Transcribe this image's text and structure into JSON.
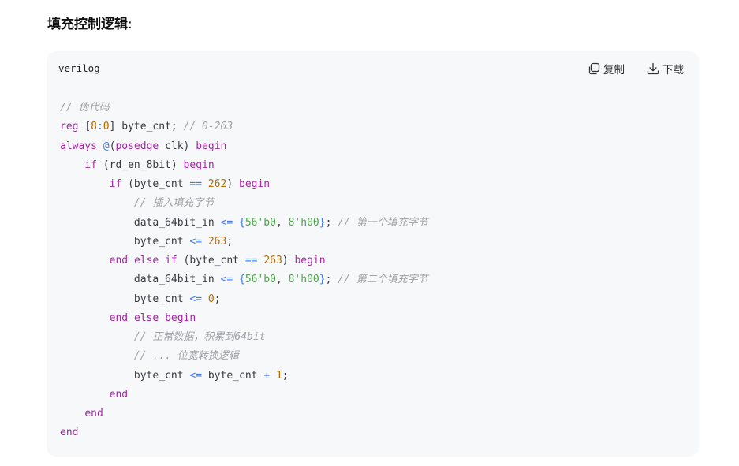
{
  "heading": {
    "title": "填充控制逻辑",
    "suffix": ":"
  },
  "code_block": {
    "language": "verilog",
    "copy_label": "复制",
    "download_label": "下载",
    "colors": {
      "background": "#f7f8fa",
      "keyword": "#a626a4",
      "number": "#b76b01",
      "string": "#50a14f",
      "operator": "#4078f2",
      "comment": "#a0a1a7",
      "plain": "#383a42"
    },
    "lines": [
      [
        {
          "t": "cmt",
          "v": "// 伪代码"
        }
      ],
      [
        {
          "t": "kw",
          "v": "reg"
        },
        {
          "t": "plain",
          "v": " ["
        },
        {
          "t": "num",
          "v": "8"
        },
        {
          "t": "op",
          "v": ":"
        },
        {
          "t": "num",
          "v": "0"
        },
        {
          "t": "plain",
          "v": "] byte_cnt; "
        },
        {
          "t": "cmt",
          "v": "// 0-263"
        }
      ],
      [
        {
          "t": "kw",
          "v": "always"
        },
        {
          "t": "plain",
          "v": " "
        },
        {
          "t": "op",
          "v": "@"
        },
        {
          "t": "plain",
          "v": "("
        },
        {
          "t": "kw",
          "v": "posedge"
        },
        {
          "t": "plain",
          "v": " clk) "
        },
        {
          "t": "kw",
          "v": "begin"
        }
      ],
      [
        {
          "t": "plain",
          "v": "    "
        },
        {
          "t": "kw",
          "v": "if"
        },
        {
          "t": "plain",
          "v": " (rd_en_8bit) "
        },
        {
          "t": "kw",
          "v": "begin"
        }
      ],
      [
        {
          "t": "plain",
          "v": "        "
        },
        {
          "t": "kw",
          "v": "if"
        },
        {
          "t": "plain",
          "v": " (byte_cnt "
        },
        {
          "t": "op",
          "v": "=="
        },
        {
          "t": "plain",
          "v": " "
        },
        {
          "t": "num",
          "v": "262"
        },
        {
          "t": "plain",
          "v": ") "
        },
        {
          "t": "kw",
          "v": "begin"
        }
      ],
      [
        {
          "t": "plain",
          "v": "            "
        },
        {
          "t": "cmt",
          "v": "// 插入填充字节"
        }
      ],
      [
        {
          "t": "plain",
          "v": "            data_64bit_in "
        },
        {
          "t": "op",
          "v": "<="
        },
        {
          "t": "plain",
          "v": " "
        },
        {
          "t": "op",
          "v": "{"
        },
        {
          "t": "str",
          "v": "56'b0"
        },
        {
          "t": "plain",
          "v": ", "
        },
        {
          "t": "str",
          "v": "8'h00"
        },
        {
          "t": "op",
          "v": "}"
        },
        {
          "t": "plain",
          "v": "; "
        },
        {
          "t": "cmt",
          "v": "// 第一个填充字节"
        }
      ],
      [
        {
          "t": "plain",
          "v": "            byte_cnt "
        },
        {
          "t": "op",
          "v": "<="
        },
        {
          "t": "plain",
          "v": " "
        },
        {
          "t": "num",
          "v": "263"
        },
        {
          "t": "plain",
          "v": ";"
        }
      ],
      [
        {
          "t": "plain",
          "v": "        "
        },
        {
          "t": "kw",
          "v": "end"
        },
        {
          "t": "plain",
          "v": " "
        },
        {
          "t": "kw",
          "v": "else"
        },
        {
          "t": "plain",
          "v": " "
        },
        {
          "t": "kw",
          "v": "if"
        },
        {
          "t": "plain",
          "v": " (byte_cnt "
        },
        {
          "t": "op",
          "v": "=="
        },
        {
          "t": "plain",
          "v": " "
        },
        {
          "t": "num",
          "v": "263"
        },
        {
          "t": "plain",
          "v": ") "
        },
        {
          "t": "kw",
          "v": "begin"
        }
      ],
      [
        {
          "t": "plain",
          "v": "            data_64bit_in "
        },
        {
          "t": "op",
          "v": "<="
        },
        {
          "t": "plain",
          "v": " "
        },
        {
          "t": "op",
          "v": "{"
        },
        {
          "t": "str",
          "v": "56'b0"
        },
        {
          "t": "plain",
          "v": ", "
        },
        {
          "t": "str",
          "v": "8'h00"
        },
        {
          "t": "op",
          "v": "}"
        },
        {
          "t": "plain",
          "v": "; "
        },
        {
          "t": "cmt",
          "v": "// 第二个填充字节"
        }
      ],
      [
        {
          "t": "plain",
          "v": "            byte_cnt "
        },
        {
          "t": "op",
          "v": "<="
        },
        {
          "t": "plain",
          "v": " "
        },
        {
          "t": "num",
          "v": "0"
        },
        {
          "t": "plain",
          "v": ";"
        }
      ],
      [
        {
          "t": "plain",
          "v": "        "
        },
        {
          "t": "kw",
          "v": "end"
        },
        {
          "t": "plain",
          "v": " "
        },
        {
          "t": "kw",
          "v": "else"
        },
        {
          "t": "plain",
          "v": " "
        },
        {
          "t": "kw",
          "v": "begin"
        }
      ],
      [
        {
          "t": "plain",
          "v": "            "
        },
        {
          "t": "cmt",
          "v": "// 正常数据，积累到64bit"
        }
      ],
      [
        {
          "t": "plain",
          "v": "            "
        },
        {
          "t": "cmt",
          "v": "// ... 位宽转换逻辑"
        }
      ],
      [
        {
          "t": "plain",
          "v": "            byte_cnt "
        },
        {
          "t": "op",
          "v": "<="
        },
        {
          "t": "plain",
          "v": " byte_cnt "
        },
        {
          "t": "op",
          "v": "+"
        },
        {
          "t": "plain",
          "v": " "
        },
        {
          "t": "num",
          "v": "1"
        },
        {
          "t": "plain",
          "v": ";"
        }
      ],
      [
        {
          "t": "plain",
          "v": "        "
        },
        {
          "t": "kw",
          "v": "end"
        }
      ],
      [
        {
          "t": "plain",
          "v": "    "
        },
        {
          "t": "kw",
          "v": "end"
        }
      ],
      [
        {
          "t": "kw",
          "v": "end"
        }
      ]
    ]
  },
  "icons": {
    "copy": "copy-icon",
    "download": "download-icon"
  }
}
